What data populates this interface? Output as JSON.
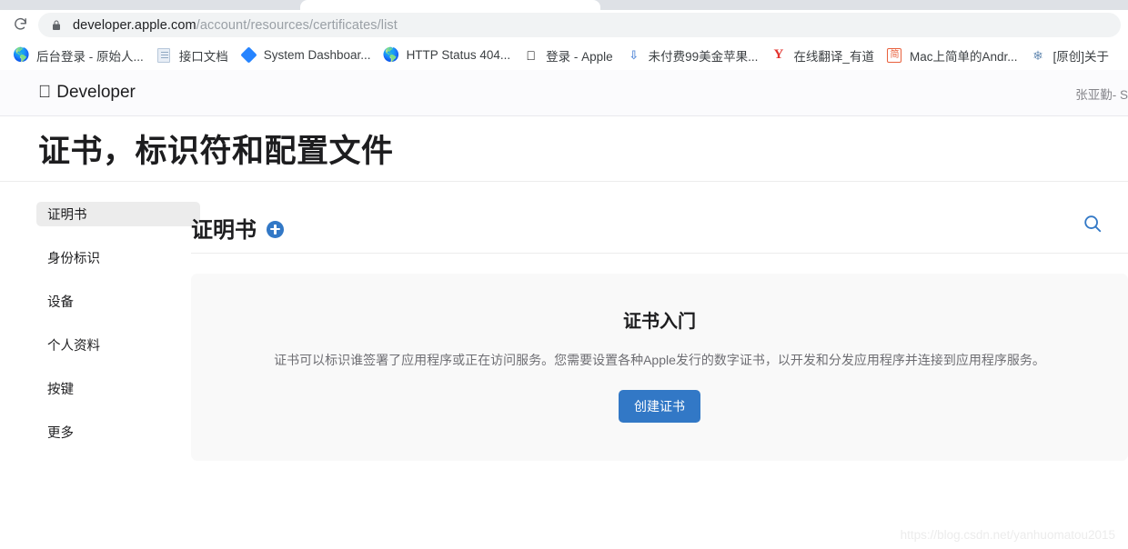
{
  "browser": {
    "reload_icon": "reload-icon",
    "lock_icon": "lock-icon",
    "url_host": "developer.apple.com",
    "url_path": "/account/resources/certificates/list",
    "bookmarks": [
      {
        "icon": "globe-icon",
        "label": "后台登录 - 原始人..."
      },
      {
        "icon": "document-icon",
        "label": "接口文档"
      },
      {
        "icon": "jira-icon",
        "label": "System Dashboar..."
      },
      {
        "icon": "globe-icon",
        "label": "HTTP Status 404..."
      },
      {
        "icon": "apple-icon",
        "label": "登录 - Apple"
      },
      {
        "icon": "chevron-icon",
        "label": "未付费99美金苹果..."
      },
      {
        "icon": "youdao-icon",
        "label": "在线翻译_有道"
      },
      {
        "icon": "jianshu-icon",
        "label": "Mac上简单的Andr..."
      },
      {
        "icon": "snowflake-icon",
        "label": "[原创]关于"
      }
    ]
  },
  "site": {
    "brand_apple_glyph": "",
    "brand_name": "Developer",
    "user_name": "张亚勤- S",
    "page_title": "证书，标识符和配置文件"
  },
  "sidebar": {
    "items": [
      {
        "label": "证明书",
        "active": true
      },
      {
        "label": "身份标识",
        "active": false
      },
      {
        "label": "设备",
        "active": false
      },
      {
        "label": "个人资料",
        "active": false
      },
      {
        "label": "按键",
        "active": false
      },
      {
        "label": "更多",
        "active": false
      }
    ]
  },
  "content": {
    "title": "证明书",
    "add_icon": "plus-circle-icon",
    "search_icon": "search-icon",
    "card": {
      "title": "证书入门",
      "description": "证书可以标识谁签署了应用程序或正在访问服务。您需要设置各种Apple发行的数字证书，以开发和分发应用程序并连接到应用程序服务。",
      "cta_label": "创建证书"
    }
  },
  "watermark": "https://blog.csdn.net/yanhuomatou2015",
  "colors": {
    "accent_blue": "#3278c6",
    "card_bg": "#f9f9f9",
    "header_bg": "#fbfbfd",
    "text_primary": "#1d1d1f",
    "text_secondary": "#6e6e73"
  }
}
